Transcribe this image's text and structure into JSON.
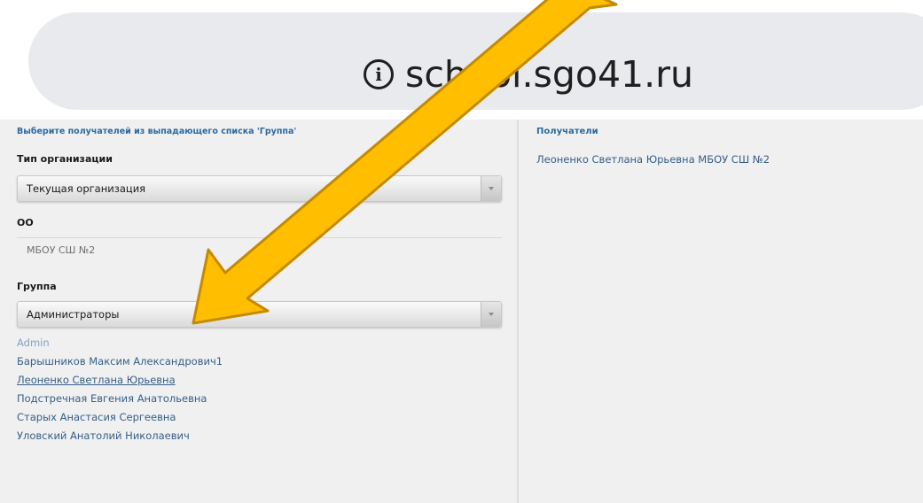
{
  "browser": {
    "url": "school.sgo41.ru",
    "info_icon": "info-circle-icon"
  },
  "left_panel": {
    "hint": "Выберите получателей из выпадающего списка 'Группа'",
    "org_type": {
      "label": "Тип организации",
      "value": "Текущая организация"
    },
    "oo": {
      "label": "ОО",
      "value": "МБОУ СШ №2"
    },
    "group": {
      "label": "Группа",
      "value": "Администраторы"
    },
    "members": [
      "Admin",
      "Барышников Максим Александрович1",
      "Леоненко Светлана Юрьевна",
      "Подстречная Евгения Анатольевна",
      "Старых Анастасия Сергеевна",
      "Уловский Анатолий Николаевич"
    ]
  },
  "right_panel": {
    "title": "Получатели",
    "recipients": [
      "Леоненко Светлана Юрьевна МБОУ СШ №2"
    ]
  },
  "colors": {
    "arrow_fill": "#ffbe00",
    "arrow_stroke": "#c48a00",
    "link": "#355e88",
    "hint": "#2a6aa0"
  }
}
